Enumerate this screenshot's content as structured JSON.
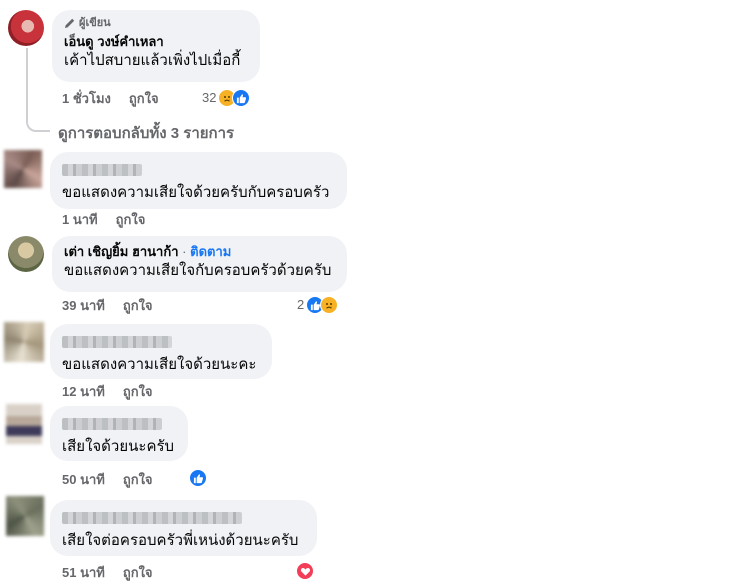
{
  "author_badge": "ผู้เขียน",
  "reply": {
    "name": "เอ็นดู วงษ์คำเหลา",
    "text": "เค้าไปสบายแล้วเพิ่งไปเมื่อกี้",
    "time": "1 ชั่วโมง",
    "like_label": "ถูกใจ",
    "reaction_count": "32",
    "reactions": [
      "sad-icon",
      "like-icon"
    ]
  },
  "view_replies": "ดูการตอบกลับทั้ง 3 รายการ",
  "comments": [
    {
      "text": "ขอแสดงความเสียใจด้วยครับกับครอบครัว",
      "time": "1 นาที",
      "like_label": "ถูกใจ"
    },
    {
      "name": "เต่า เชิญยิ้ม ฮานาก้า",
      "follow_label": "ติดตาม",
      "separator": "·",
      "text": "ขอแสดงความเสียใจกับครอบครัวด้วยครับ",
      "time": "39 นาที",
      "like_label": "ถูกใจ",
      "reaction_count": "2",
      "reactions": [
        "like-icon",
        "sad-icon"
      ]
    },
    {
      "text": "ขอแสดงความเสียใจด้วยนะคะ",
      "time": "12 นาที",
      "like_label": "ถูกใจ"
    },
    {
      "text": "เสียใจด้วยนะครับ",
      "time": "50 นาที",
      "like_label": "ถูกใจ",
      "reactions": [
        "like-icon"
      ]
    },
    {
      "text": "เสียใจต่อครอบครัวพี่เหน่งด้วยนะครับ",
      "time": "51 นาที",
      "like_label": "ถูกใจ",
      "reactions": [
        "love-icon"
      ]
    }
  ],
  "colors": {
    "bubble": "#f0f2f5",
    "meta": "#65676b",
    "accent": "#1877f2",
    "sad": "#f7b125",
    "love": "#f33e58"
  }
}
